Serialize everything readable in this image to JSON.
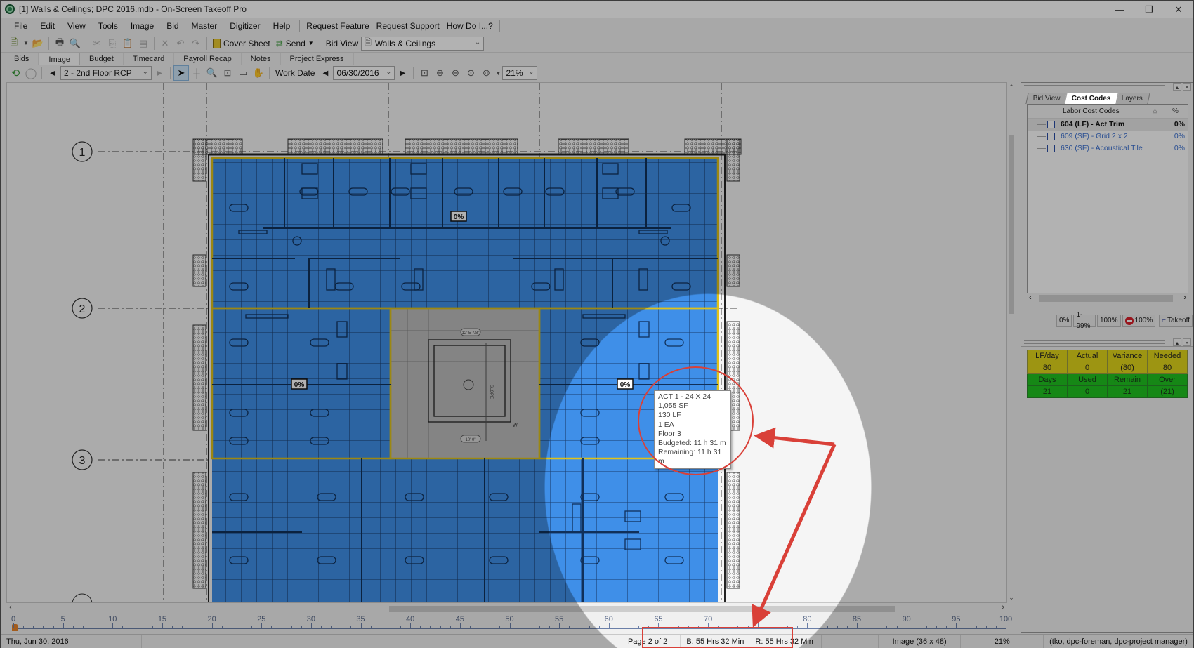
{
  "window": {
    "title": "[1] Walls & Ceilings; DPC 2016.mdb - On-Screen Takeoff Pro",
    "controls": [
      "minimize",
      "restore",
      "close"
    ]
  },
  "menu": {
    "items": [
      "File",
      "Edit",
      "View",
      "Tools",
      "Image",
      "Bid",
      "Master",
      "Digitizer",
      "Help"
    ],
    "extra": [
      "Request Feature",
      "Request Support",
      "How Do I...?"
    ]
  },
  "toolbar": {
    "cover_sheet": "Cover Sheet",
    "send": "Send",
    "bid_view_label": "Bid View",
    "bid_view_value": "Walls & Ceilings"
  },
  "tabs": {
    "items": [
      "Bids",
      "Image",
      "Budget",
      "Timecard",
      "Payroll Recap",
      "Notes",
      "Project Express"
    ],
    "active": "Image"
  },
  "image_toolbar": {
    "page_select": "2 - 2nd Floor RCP",
    "work_date_label": "Work Date",
    "work_date": "06/30/2016",
    "zoom": "21%"
  },
  "plan": {
    "grid_markers": [
      "1",
      "2",
      "3"
    ],
    "area_labels": [
      "0%",
      "0%",
      "0%"
    ],
    "room_tags": [
      "12' 5 7/8\"",
      "10' 0\"",
      "SLOPE",
      "W"
    ],
    "colors": {
      "area_fill": "#3f8fe8",
      "area_border": "#e0c21a",
      "grid_line": "#1a3d6e"
    }
  },
  "tooltip": {
    "lines": [
      "ACT 1 - 24 X 24",
      "1,055 SF",
      "130 LF",
      "1 EA",
      "Floor 3",
      "Budgeted: 11 h 31 m",
      "Remaining: 11 h 31 m"
    ]
  },
  "ruler": {
    "labels": [
      "0",
      "5",
      "10",
      "15",
      "20",
      "25",
      "30",
      "35",
      "40",
      "45",
      "50",
      "55",
      "60",
      "65",
      "70",
      "75",
      "80",
      "85",
      "90",
      "95",
      "100"
    ],
    "marker_value": 0
  },
  "status": {
    "date": "Thu, Jun 30, 2016",
    "page": "Page 2 of 2",
    "budgeted": "B: 55 Hrs 32 Min",
    "remaining": "R: 55 Hrs 32 Min",
    "image": "Image (36 x 48)",
    "zoom": "21%",
    "user": "(tko, dpc-foreman, dpc-project manager)"
  },
  "right_panel": {
    "tabs": [
      "Bid View",
      "Cost Codes",
      "Layers"
    ],
    "active_tab": "Cost Codes",
    "header": "Labor Cost Codes",
    "header_pct": "%",
    "rows": [
      {
        "label": "604 (LF) - Act  Trim",
        "pct": "0%"
      },
      {
        "label": "609 (SF) - Grid 2 x 2",
        "pct": "0%"
      },
      {
        "label": "630 (SF) - Acoustical Tile",
        "pct": "0%"
      }
    ],
    "filters": [
      "0%",
      "1-99%",
      "100%",
      "100%",
      "Takeoff"
    ]
  },
  "stats_panel": {
    "row1": [
      "LF/day",
      "Actual",
      "Variance",
      "Needed"
    ],
    "row2": [
      "80",
      "0",
      "(80)",
      "80"
    ],
    "row3": [
      "Days",
      "Used",
      "Remain",
      "Over"
    ],
    "row4": [
      "21",
      "0",
      "21",
      "(21)"
    ],
    "colors": {
      "yellow": "#e1d51a",
      "green": "#1fc21f"
    }
  },
  "annotation": {
    "color": "#d94038"
  }
}
